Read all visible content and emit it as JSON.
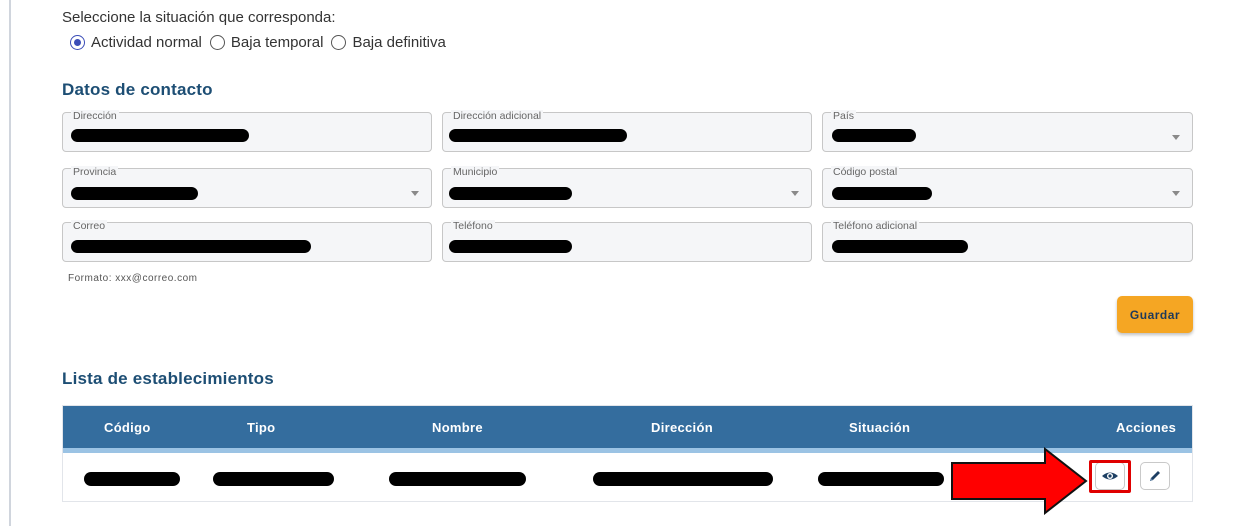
{
  "situation": {
    "prompt": "Seleccione la situación que corresponda:",
    "options": [
      {
        "label": "Actividad normal",
        "checked": true
      },
      {
        "label": "Baja temporal",
        "checked": false
      },
      {
        "label": "Baja definitiva",
        "checked": false
      }
    ]
  },
  "contact": {
    "title": "Datos de contacto",
    "fields": {
      "direccion": "Dirección",
      "direccion_adicional": "Dirección adicional",
      "pais": "País",
      "provincia": "Provincia",
      "municipio": "Municipio",
      "codigo_postal": "Código postal",
      "correo": "Correo",
      "telefono": "Teléfono",
      "telefono_adicional": "Teléfono adicional"
    },
    "email_hint": "Formato: xxx@correo.com",
    "save_label": "Guardar"
  },
  "establishments": {
    "title": "Lista de establecimientos",
    "columns": [
      "Código",
      "Tipo",
      "Nombre",
      "Dirección",
      "Situación",
      "Acciones"
    ]
  },
  "icons": {
    "view": "eye-icon",
    "edit": "pencil-icon",
    "dropdown": "chevron-down-icon",
    "annotation": "red-arrow"
  },
  "colors": {
    "primary": "#1d4e74",
    "table_header": "#346d9e",
    "accent_button": "#f5a623",
    "radio_selected": "#3b4db8",
    "highlight": "#e00000"
  }
}
